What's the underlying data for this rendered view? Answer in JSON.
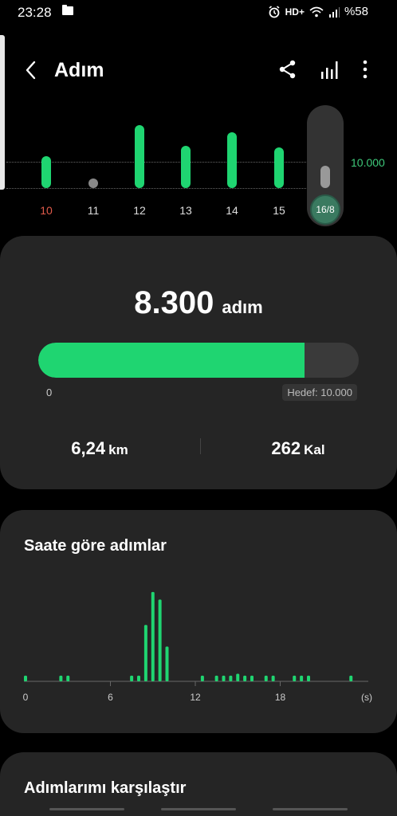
{
  "status": {
    "time": "23:28",
    "network": "HD+",
    "battery": "%58",
    "icons": [
      "folder-icon",
      "alarm-icon",
      "wifi-icon",
      "signal-icon"
    ]
  },
  "header": {
    "title": "Adım",
    "back_icon": "back-arrow-icon",
    "share_icon": "share-icon",
    "stats_icon": "bar-stats-icon",
    "more_icon": "more-vert-icon"
  },
  "week": {
    "goal_label": "10.000",
    "days": [
      {
        "label": "10",
        "steps": 4300,
        "highlight": true
      },
      {
        "label": "11",
        "steps": 0,
        "highlight": false
      },
      {
        "label": "12",
        "steps": 8600,
        "highlight": false
      },
      {
        "label": "13",
        "steps": 5800,
        "highlight": false
      },
      {
        "label": "14",
        "steps": 7600,
        "highlight": false
      },
      {
        "label": "15",
        "steps": 5500,
        "highlight": false
      }
    ],
    "selected_label": "16/8"
  },
  "summary": {
    "steps": "8.300",
    "steps_unit": "adım",
    "progress": 0.83,
    "start_label": "0",
    "goal_label": "Hedef: 10.000",
    "distance_value": "6,24",
    "distance_unit": "km",
    "calories_value": "262",
    "calories_unit": "Kal"
  },
  "hourly": {
    "title": "Saate göre adımlar",
    "x_ticks": [
      "0",
      "6",
      "12",
      "18",
      "(s)"
    ]
  },
  "compare": {
    "title": "Adımlarımı karşılaştır"
  },
  "colors": {
    "accent": "#1fd571",
    "card": "#252525",
    "background": "#000000"
  },
  "chart_data": {
    "type": "bar",
    "title": "Saate göre adımlar",
    "xlabel": "(s)",
    "ylabel": "",
    "xlim": [
      0,
      24
    ],
    "x": [
      0,
      2.5,
      3,
      7.5,
      8,
      8.5,
      9,
      9.5,
      10,
      12.5,
      13.5,
      14,
      14.5,
      15,
      15.5,
      16,
      17,
      17.5,
      19,
      19.5,
      20,
      23
    ],
    "values": [
      60,
      60,
      60,
      60,
      60,
      600,
      950,
      870,
      370,
      60,
      60,
      60,
      60,
      80,
      60,
      60,
      60,
      60,
      60,
      60,
      60,
      60
    ]
  }
}
